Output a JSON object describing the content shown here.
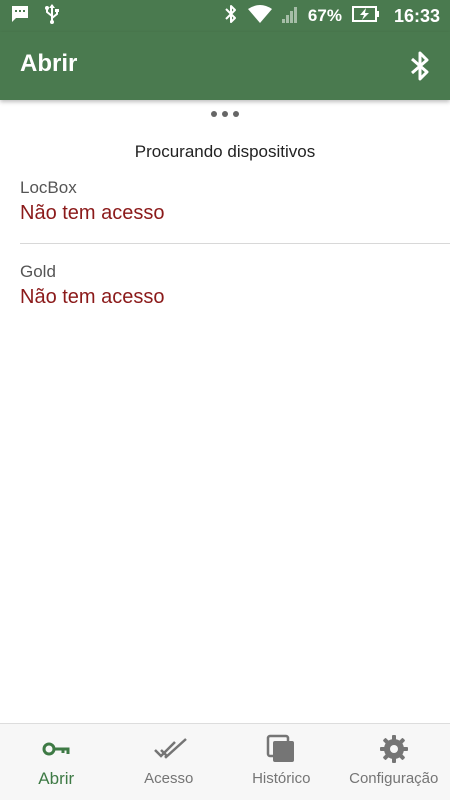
{
  "status_bar": {
    "battery_percent": "67%",
    "time": "16:33",
    "icons": [
      "message-icon",
      "usb-icon",
      "bluetooth-icon",
      "wifi-icon",
      "signal-icon",
      "battery-charging-icon"
    ]
  },
  "app_bar": {
    "title": "Abrir",
    "action_icon": "bluetooth-icon"
  },
  "main": {
    "loading_indicator": "dots",
    "searching_text": "Procurando dispositivos",
    "devices": [
      {
        "name": "LocBox",
        "status": "Não tem acesso"
      },
      {
        "name": "Gold",
        "status": "Não tem acesso"
      }
    ]
  },
  "bottom_nav": {
    "items": [
      {
        "label": "Abrir",
        "icon": "key-icon",
        "active": true
      },
      {
        "label": "Acesso",
        "icon": "double-check-icon",
        "active": false
      },
      {
        "label": "Histórico",
        "icon": "history-stack-icon",
        "active": false
      },
      {
        "label": "Configuração",
        "icon": "gear-icon",
        "active": false
      }
    ]
  },
  "colors": {
    "primary": "#4a7a4f",
    "active_nav": "#3e7a45",
    "status_error": "#8b1a1a",
    "inactive_nav": "#757575"
  }
}
